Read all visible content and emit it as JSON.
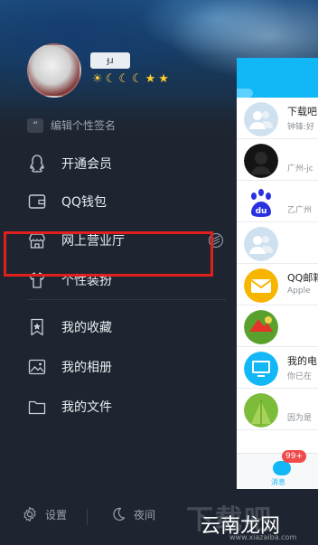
{
  "profile": {
    "nickname": "ɟɹ",
    "badges": [
      "☀",
      "☾",
      "☾",
      "☾",
      "★",
      "★"
    ],
    "signature_placeholder": "编辑个性签名"
  },
  "menu": {
    "items": [
      {
        "label": "开通会员",
        "icon": "penguin-icon"
      },
      {
        "label": "QQ钱包",
        "icon": "wallet-icon"
      },
      {
        "label": "网上营业厅",
        "icon": "store-icon"
      },
      {
        "label": "个性装扮",
        "icon": "tshirt-icon"
      },
      {
        "label": "我的收藏",
        "icon": "bookmark-star-icon"
      },
      {
        "label": "我的相册",
        "icon": "photo-icon"
      },
      {
        "label": "我的文件",
        "icon": "folder-icon"
      }
    ]
  },
  "footer": {
    "settings_label": "设置",
    "night_label": "夜间"
  },
  "chats": [
    {
      "name": "下载吧",
      "msg": "钟锋:好"
    },
    {
      "name": "",
      "msg": "广州-jc"
    },
    {
      "name": "",
      "msg": "乙广州"
    },
    {
      "name": "",
      "msg": ""
    },
    {
      "name": "QQ邮箱",
      "msg": "Apple"
    },
    {
      "name": "",
      "msg": ""
    },
    {
      "name": "我的电",
      "msg": "你已在"
    },
    {
      "name": "",
      "msg": "因为是"
    }
  ],
  "tabbar": {
    "messages_label": "消息",
    "badge": "99+"
  },
  "watermark": {
    "big": "下载吧",
    "text": "云南龙网",
    "url": "www.xiazaiba.com"
  },
  "colors": {
    "highlight": "#e0201c",
    "qq_blue": "#12b7f5",
    "drawer_bg": "#1e2530"
  }
}
